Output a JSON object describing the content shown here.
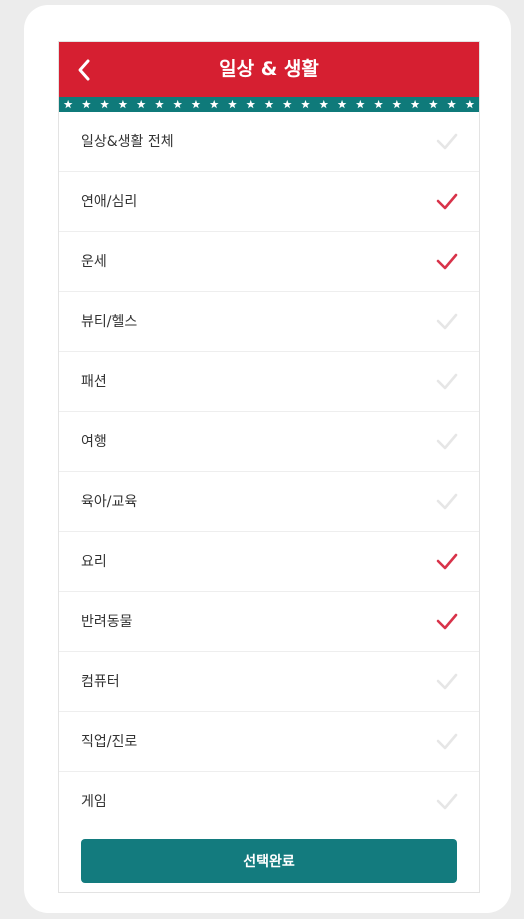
{
  "header": {
    "title": "일상 & 생활",
    "back_icon": "chevron-left-icon",
    "color": "#d61f31"
  },
  "star_border_color": "#0f7a7a",
  "list": {
    "items": [
      {
        "label": "일상&생활 전체",
        "selected": false
      },
      {
        "label": "연애/심리",
        "selected": true
      },
      {
        "label": "운세",
        "selected": true
      },
      {
        "label": "뷰티/헬스",
        "selected": false
      },
      {
        "label": "패션",
        "selected": false
      },
      {
        "label": "여행",
        "selected": false
      },
      {
        "label": "육아/교육",
        "selected": false
      },
      {
        "label": "요리",
        "selected": true
      },
      {
        "label": "반려동물",
        "selected": true
      },
      {
        "label": "컴퓨터",
        "selected": false
      },
      {
        "label": "직업/진로",
        "selected": false
      },
      {
        "label": "게임",
        "selected": false
      }
    ],
    "check_icon": "checkmark-icon",
    "check_color_selected": "#d8334a",
    "check_color_unselected": "#e6e6e6"
  },
  "footer": {
    "done_label": "선택완료",
    "color": "#137b7e"
  }
}
